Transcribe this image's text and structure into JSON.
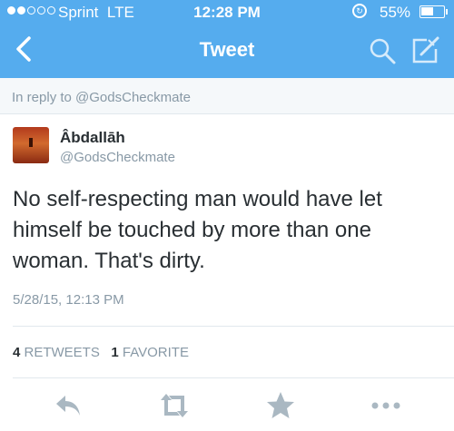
{
  "status_bar": {
    "carrier": "Sprint",
    "network": "LTE",
    "time": "12:28 PM",
    "battery_percent": "55%",
    "battery_level": 0.55
  },
  "nav": {
    "title": "Tweet",
    "back_icon": "chevron-left-icon",
    "search_icon": "search-icon",
    "compose_icon": "compose-icon"
  },
  "reply_banner": "In reply to @GodsCheckmate",
  "tweet": {
    "author_name": "Âbdallāh",
    "author_handle": "@GodsCheckmate",
    "text": "No self-respecting man would have let himself be touched by more than one woman. That's dirty.",
    "timestamp": "5/28/15, 12:13 PM",
    "retweet_count": "4",
    "retweet_label": "RETWEETS",
    "favorite_count": "1",
    "favorite_label": "FAVORITE"
  },
  "actions": [
    "reply-icon",
    "retweet-icon",
    "favorite-icon",
    "more-icon"
  ],
  "colors": {
    "brand": "#55acee",
    "muted": "#8899a6",
    "text": "#292f33",
    "action": "#aab8c2"
  }
}
